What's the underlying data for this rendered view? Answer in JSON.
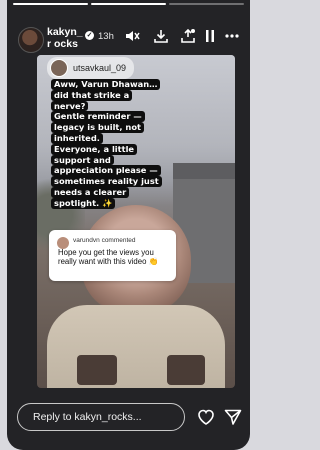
{
  "header": {
    "username": "kakyn_rocks",
    "username_display": "kakyn_r ocks",
    "verified_glyph": "✓",
    "time": "13h",
    "progress_segments": 3,
    "progress_done": 2,
    "icons": [
      "mute-icon",
      "download-icon",
      "save-to-collection-icon",
      "pause-icon",
      "more-options-icon"
    ]
  },
  "story": {
    "overlay_username": "utsavkaul_09",
    "caption_lines": [
      "Aww, Varun Dhawan…",
      "did that strike a",
      "nerve?",
      "Gentle reminder —",
      "legacy is built, not",
      "inherited.",
      "Everyone, a little",
      "support and",
      "appreciation please —",
      "sometimes reality just",
      "needs a clearer",
      "spotlight. ✨"
    ],
    "comment": {
      "author": "varundvn",
      "action": "commented",
      "text": "Hope you get the views you really want with this video 👏"
    }
  },
  "footer": {
    "reply_placeholder": "Reply to kakyn_rocks...",
    "icons": [
      "like-heart-icon",
      "share-send-icon"
    ]
  },
  "colors": {
    "background": "#232326",
    "caption_bg": "#0e0e0e",
    "text": "#ffffff"
  }
}
